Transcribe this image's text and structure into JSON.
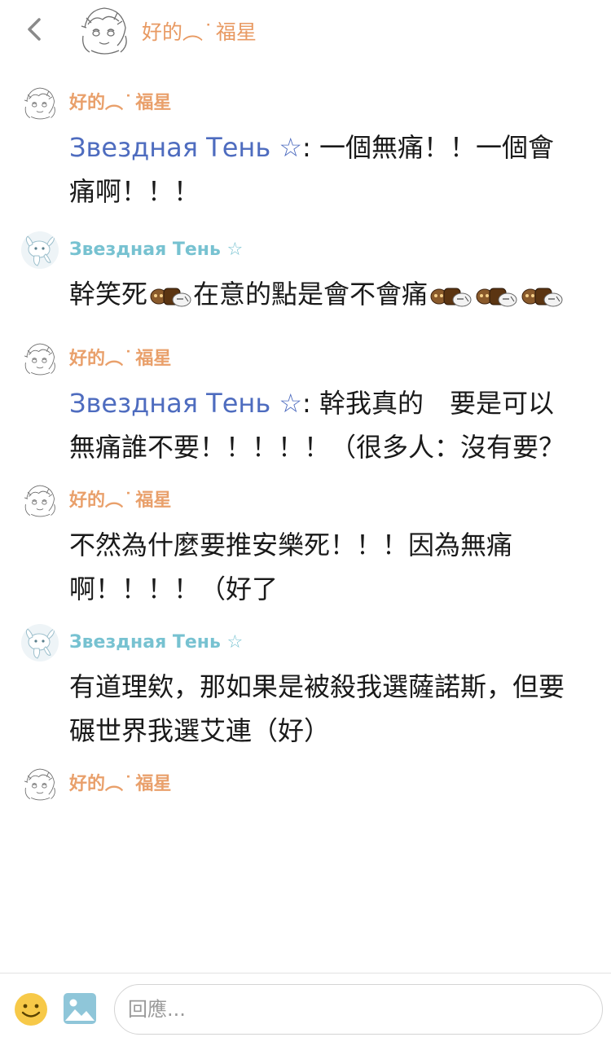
{
  "header": {
    "back_icon": "chevron-left-icon",
    "title": "好的︵ ͘ 福星"
  },
  "messages": [
    {
      "author": "好的︵ ͘ 福星",
      "author_color": "#e9a06b",
      "mention": "Звездная Тень ☆",
      "text": ": 一個無痛！！一個會痛啊！！！"
    },
    {
      "author": "Звездная Тень ☆",
      "author_color": "#77c2d1",
      "text_before": "幹笑死",
      "text_middle": "在意的點是會不會痛",
      "sticker_icon": "chick-laughing-sticker-icon"
    },
    {
      "author": "好的︵ ͘ 福星",
      "author_color": "#e9a06b",
      "mention": "Звездная Тень ☆",
      "text": ": 幹我真的　要是可以無痛誰不要！！！！！（很多人：沒有要？"
    },
    {
      "author": "好的︵ ͘ 福星",
      "author_color": "#e9a06b",
      "text": "不然為什麼要推安樂死！！！因為無痛啊！！！！（好了"
    },
    {
      "author": "Звездная Тень ☆",
      "author_color": "#77c2d1",
      "text": "有道理欸，那如果是被殺我選薩諾斯，但要碾世界我選艾連（好）"
    },
    {
      "author": "好的︵ ͘ 福星",
      "author_color": "#e9a06b"
    }
  ],
  "composer": {
    "emoji_icon": "smiley-face-icon",
    "image_icon": "image-upload-icon",
    "placeholder": "回應..."
  },
  "colors": {
    "mention": "#4e6cbf",
    "emoji_yellow": "#f7c948",
    "image_blue": "#8fc6d9"
  }
}
